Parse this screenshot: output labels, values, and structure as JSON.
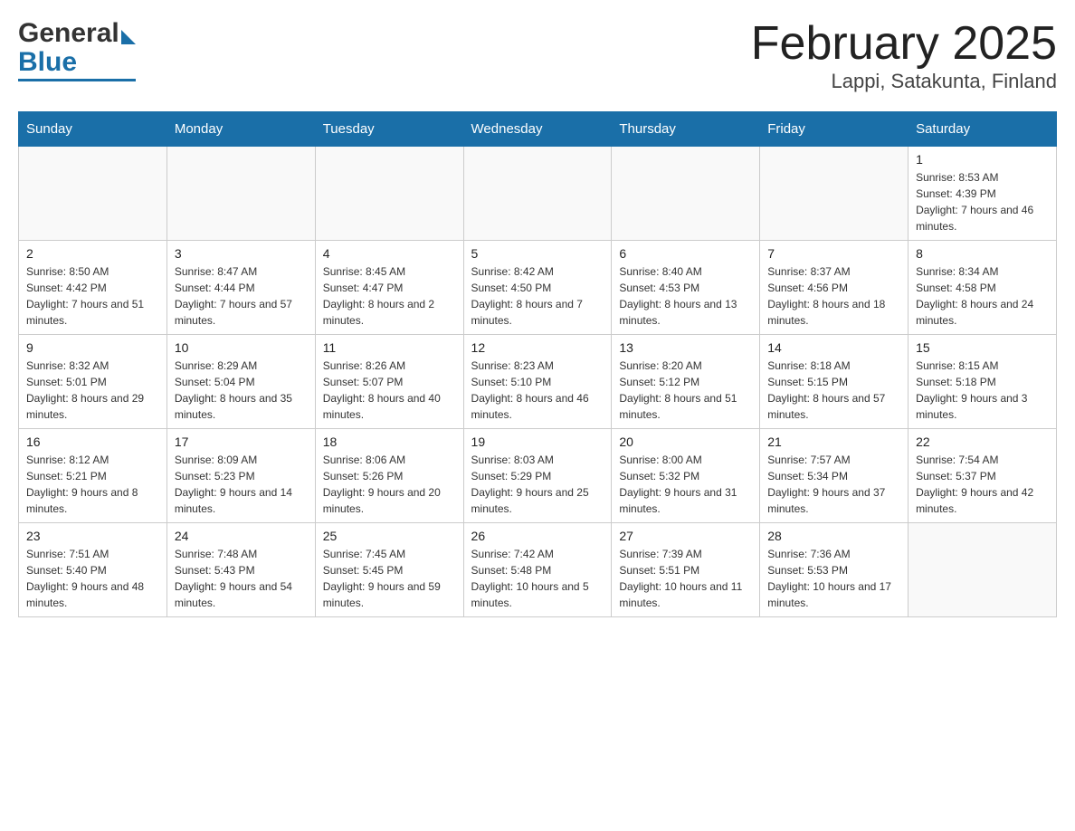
{
  "header": {
    "title": "February 2025",
    "subtitle": "Lappi, Satakunta, Finland",
    "logo_general": "General",
    "logo_blue": "Blue"
  },
  "calendar": {
    "days_of_week": [
      "Sunday",
      "Monday",
      "Tuesday",
      "Wednesday",
      "Thursday",
      "Friday",
      "Saturday"
    ],
    "weeks": [
      [
        {
          "num": "",
          "info": ""
        },
        {
          "num": "",
          "info": ""
        },
        {
          "num": "",
          "info": ""
        },
        {
          "num": "",
          "info": ""
        },
        {
          "num": "",
          "info": ""
        },
        {
          "num": "",
          "info": ""
        },
        {
          "num": "1",
          "info": "Sunrise: 8:53 AM\nSunset: 4:39 PM\nDaylight: 7 hours and 46 minutes."
        }
      ],
      [
        {
          "num": "2",
          "info": "Sunrise: 8:50 AM\nSunset: 4:42 PM\nDaylight: 7 hours and 51 minutes."
        },
        {
          "num": "3",
          "info": "Sunrise: 8:47 AM\nSunset: 4:44 PM\nDaylight: 7 hours and 57 minutes."
        },
        {
          "num": "4",
          "info": "Sunrise: 8:45 AM\nSunset: 4:47 PM\nDaylight: 8 hours and 2 minutes."
        },
        {
          "num": "5",
          "info": "Sunrise: 8:42 AM\nSunset: 4:50 PM\nDaylight: 8 hours and 7 minutes."
        },
        {
          "num": "6",
          "info": "Sunrise: 8:40 AM\nSunset: 4:53 PM\nDaylight: 8 hours and 13 minutes."
        },
        {
          "num": "7",
          "info": "Sunrise: 8:37 AM\nSunset: 4:56 PM\nDaylight: 8 hours and 18 minutes."
        },
        {
          "num": "8",
          "info": "Sunrise: 8:34 AM\nSunset: 4:58 PM\nDaylight: 8 hours and 24 minutes."
        }
      ],
      [
        {
          "num": "9",
          "info": "Sunrise: 8:32 AM\nSunset: 5:01 PM\nDaylight: 8 hours and 29 minutes."
        },
        {
          "num": "10",
          "info": "Sunrise: 8:29 AM\nSunset: 5:04 PM\nDaylight: 8 hours and 35 minutes."
        },
        {
          "num": "11",
          "info": "Sunrise: 8:26 AM\nSunset: 5:07 PM\nDaylight: 8 hours and 40 minutes."
        },
        {
          "num": "12",
          "info": "Sunrise: 8:23 AM\nSunset: 5:10 PM\nDaylight: 8 hours and 46 minutes."
        },
        {
          "num": "13",
          "info": "Sunrise: 8:20 AM\nSunset: 5:12 PM\nDaylight: 8 hours and 51 minutes."
        },
        {
          "num": "14",
          "info": "Sunrise: 8:18 AM\nSunset: 5:15 PM\nDaylight: 8 hours and 57 minutes."
        },
        {
          "num": "15",
          "info": "Sunrise: 8:15 AM\nSunset: 5:18 PM\nDaylight: 9 hours and 3 minutes."
        }
      ],
      [
        {
          "num": "16",
          "info": "Sunrise: 8:12 AM\nSunset: 5:21 PM\nDaylight: 9 hours and 8 minutes."
        },
        {
          "num": "17",
          "info": "Sunrise: 8:09 AM\nSunset: 5:23 PM\nDaylight: 9 hours and 14 minutes."
        },
        {
          "num": "18",
          "info": "Sunrise: 8:06 AM\nSunset: 5:26 PM\nDaylight: 9 hours and 20 minutes."
        },
        {
          "num": "19",
          "info": "Sunrise: 8:03 AM\nSunset: 5:29 PM\nDaylight: 9 hours and 25 minutes."
        },
        {
          "num": "20",
          "info": "Sunrise: 8:00 AM\nSunset: 5:32 PM\nDaylight: 9 hours and 31 minutes."
        },
        {
          "num": "21",
          "info": "Sunrise: 7:57 AM\nSunset: 5:34 PM\nDaylight: 9 hours and 37 minutes."
        },
        {
          "num": "22",
          "info": "Sunrise: 7:54 AM\nSunset: 5:37 PM\nDaylight: 9 hours and 42 minutes."
        }
      ],
      [
        {
          "num": "23",
          "info": "Sunrise: 7:51 AM\nSunset: 5:40 PM\nDaylight: 9 hours and 48 minutes."
        },
        {
          "num": "24",
          "info": "Sunrise: 7:48 AM\nSunset: 5:43 PM\nDaylight: 9 hours and 54 minutes."
        },
        {
          "num": "25",
          "info": "Sunrise: 7:45 AM\nSunset: 5:45 PM\nDaylight: 9 hours and 59 minutes."
        },
        {
          "num": "26",
          "info": "Sunrise: 7:42 AM\nSunset: 5:48 PM\nDaylight: 10 hours and 5 minutes."
        },
        {
          "num": "27",
          "info": "Sunrise: 7:39 AM\nSunset: 5:51 PM\nDaylight: 10 hours and 11 minutes."
        },
        {
          "num": "28",
          "info": "Sunrise: 7:36 AM\nSunset: 5:53 PM\nDaylight: 10 hours and 17 minutes."
        },
        {
          "num": "",
          "info": ""
        }
      ]
    ]
  }
}
